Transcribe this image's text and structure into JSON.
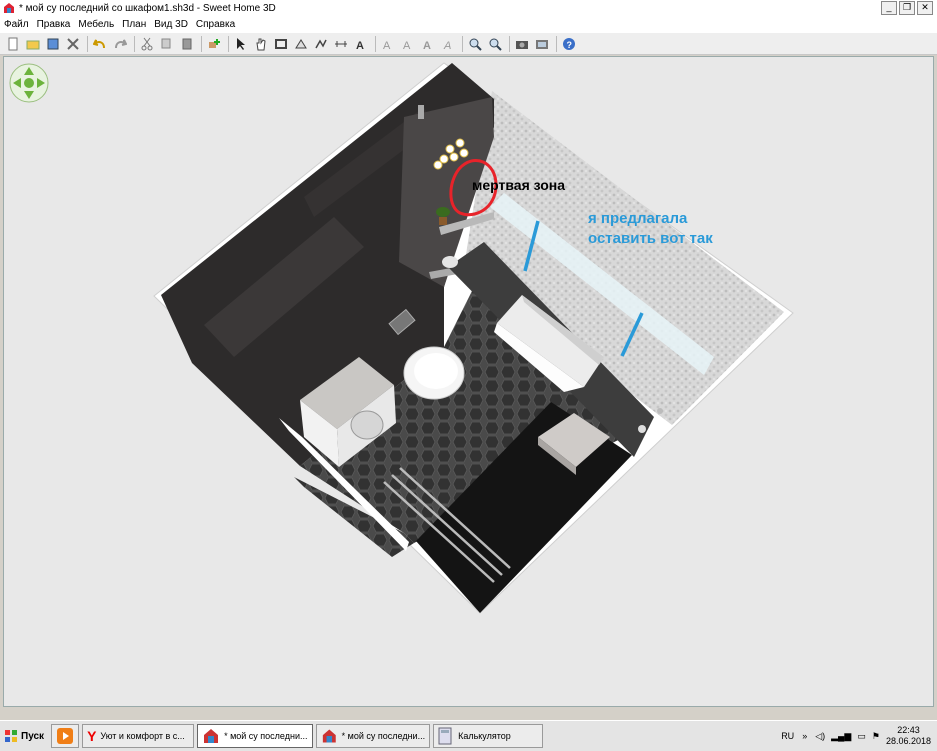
{
  "window": {
    "title": "* мой су последний со шкафом1.sh3d - Sweet Home 3D",
    "min": "_",
    "restore": "❐",
    "close": "✕"
  },
  "menu": [
    "Файл",
    "Правка",
    "Мебель",
    "План",
    "Вид 3D",
    "Справка"
  ],
  "toolbar": {
    "icons": [
      "new-file-icon",
      "open-icon",
      "save-icon",
      "cut-tools-icon",
      "undo-icon",
      "redo-icon",
      "cut-icon",
      "copy-icon",
      "paste-icon",
      "add-furniture-icon",
      "select-icon",
      "pan-icon",
      "create-walls-icon",
      "create-rooms-icon",
      "create-polylines-icon",
      "create-dimensions-icon",
      "add-text-icon",
      "text-style-icon",
      "text-style-2-icon",
      "text-bold-icon",
      "text-italic-icon",
      "zoom-in-icon",
      "zoom-out-icon",
      "photo-icon",
      "video-icon",
      "help-icon"
    ]
  },
  "annotations": {
    "dead_zone": "мертвая зона",
    "proposal_line1": "я предлагала",
    "proposal_line2": "оставить вот так"
  },
  "colors": {
    "annotation_red": "#e8232a",
    "annotation_blue": "#2a9ad8",
    "floor_dark": "#151515",
    "tile_hex": "#3a3a3a",
    "wall_dark": "#2d2b2b"
  },
  "taskbar": {
    "start": "Пуск",
    "tasks": [
      {
        "label": "",
        "icon": "media-player-icon"
      },
      {
        "label": "Уют и комфорт в с...",
        "icon": "yandex-icon"
      },
      {
        "label": "* мой су последни...",
        "icon": "sweethome-icon",
        "active": true
      },
      {
        "label": "* мой су последни...",
        "icon": "sweethome-icon"
      },
      {
        "label": "Калькулятор",
        "icon": "calculator-icon"
      }
    ],
    "lang": "RU",
    "time": "22:43",
    "date": "28.06.2018"
  }
}
